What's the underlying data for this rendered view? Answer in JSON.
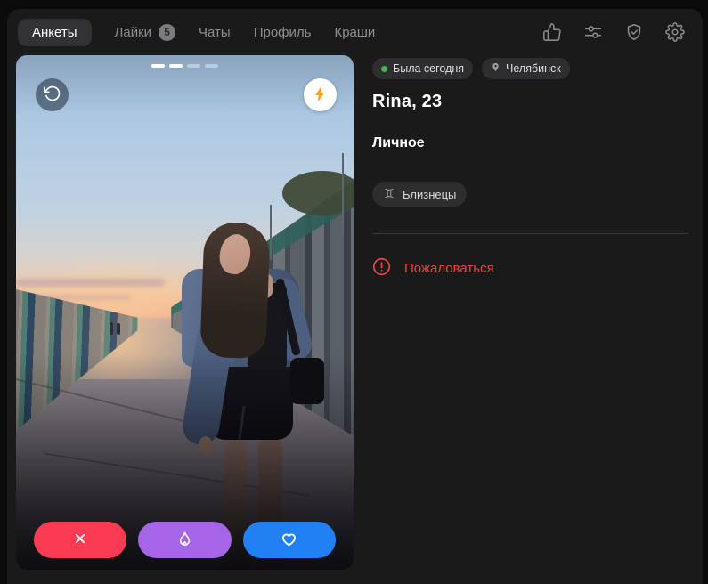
{
  "nav": {
    "tabs": [
      {
        "label": "Анкеты",
        "active": true
      },
      {
        "label": "Лайки",
        "badge": "5"
      },
      {
        "label": "Чаты"
      },
      {
        "label": "Профиль"
      },
      {
        "label": "Краши"
      }
    ],
    "action_icons": [
      "like-icon",
      "filters-icon",
      "shield-check-icon",
      "settings-gear-icon"
    ]
  },
  "photo": {
    "indicators": {
      "total": 4,
      "active_count": 2
    },
    "overlay_buttons": [
      "rotate-ccw-icon",
      "boost-lightning-icon"
    ],
    "actions": [
      {
        "name": "dislike",
        "icon": "close-x-icon",
        "color": "#fb3a53"
      },
      {
        "name": "superlike",
        "icon": "flame-icon",
        "color": "#a664e8"
      },
      {
        "name": "like",
        "icon": "heart-icon",
        "color": "#2180f4"
      }
    ]
  },
  "profile": {
    "status_badge": "Была сегодня",
    "city_badge": "Челябинск",
    "name_age": "Rina, 23",
    "section_title": "Личное",
    "tags": [
      {
        "icon": "gemini-zodiac-icon",
        "label": "Близнецы"
      }
    ],
    "report_label": "Пожаловаться"
  },
  "colors": {
    "online_green": "#4bb34b",
    "report_red": "#e64646",
    "boost_orange": "#f7a220",
    "action_red": "#fb3a53",
    "action_purple": "#a664e8",
    "action_blue": "#2180f4"
  }
}
